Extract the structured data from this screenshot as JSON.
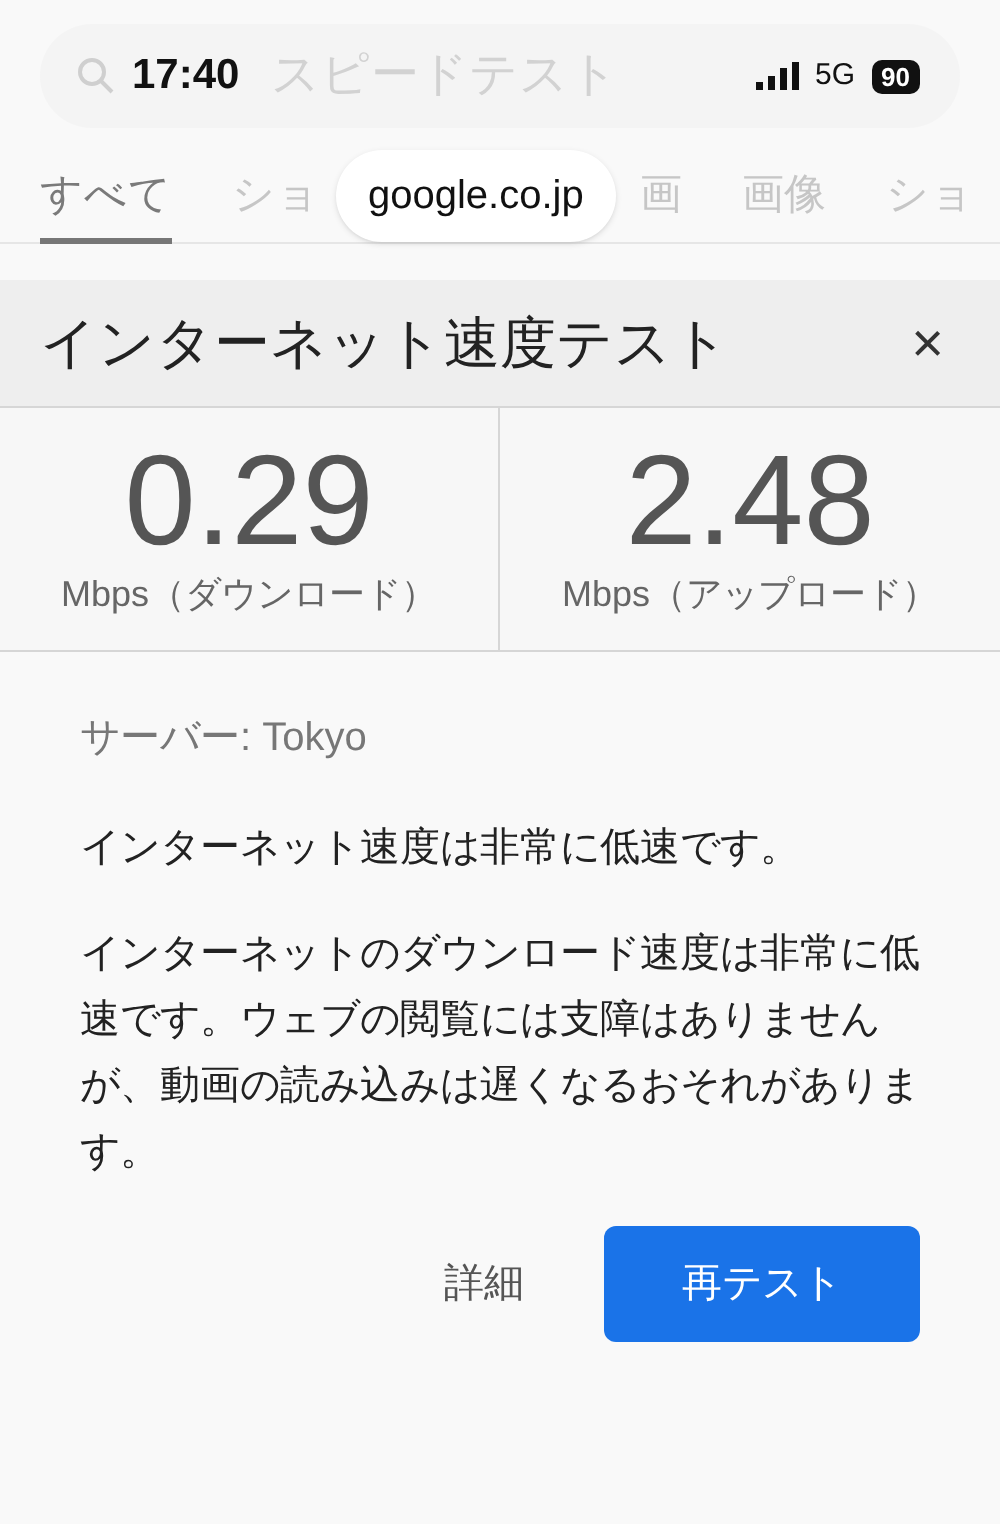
{
  "status_bar": {
    "time": "17:40",
    "network": "5G",
    "battery": "90"
  },
  "search": {
    "value": "スピードテスト"
  },
  "tabs": [
    {
      "label": "すべて",
      "selected": true
    },
    {
      "label": "ショ",
      "selected": false
    },
    {
      "label": "画",
      "selected": false
    },
    {
      "label": "画像",
      "selected": false
    },
    {
      "label": "ショ",
      "selected": false
    }
  ],
  "url_pill": "google.co.jp",
  "card": {
    "title": "インターネット速度テスト",
    "close": "×",
    "metrics": [
      {
        "value": "0.29",
        "unit": "Mbps（ダウンロード）"
      },
      {
        "value": "2.48",
        "unit": "Mbps（アップロード）"
      }
    ],
    "server": "サーバー: Tokyo",
    "summary": "インターネット速度は非常に低速です。",
    "detail": "インターネットのダウンロード速度は非常に低速です。ウェブの閲覧には支障はありませんが、動画の読み込みは遅くなるおそれがあります。",
    "buttons": [
      {
        "label": "詳細",
        "kind": "text"
      },
      {
        "label": "再テスト",
        "kind": "primary"
      }
    ]
  }
}
